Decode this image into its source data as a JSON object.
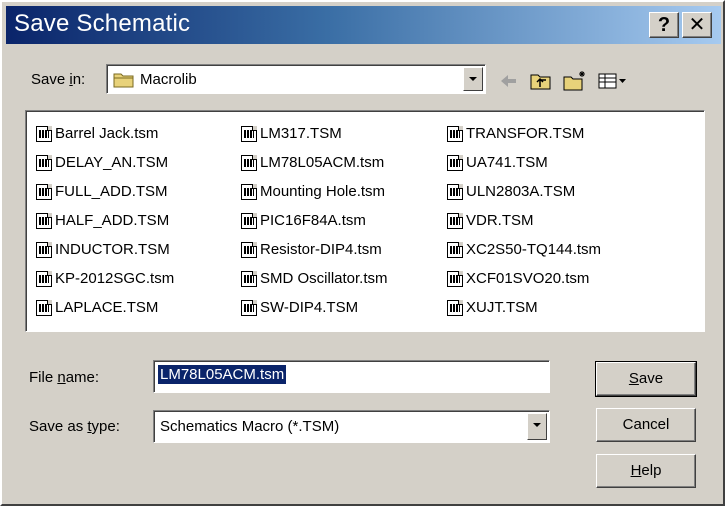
{
  "window": {
    "title": "Save Schematic",
    "help_glyph": "?",
    "close_glyph": "✕"
  },
  "save_in": {
    "label_pre": "Save ",
    "label_u": "i",
    "label_post": "n:",
    "value": "Macrolib",
    "folder_icon": "folder-icon"
  },
  "toolbar": {
    "back_icon": "back-arrow-icon",
    "up_icon": "up-folder-icon",
    "new_folder_icon": "new-folder-icon",
    "view_icon": "view-menu-icon"
  },
  "files": {
    "col1": [
      "Barrel Jack.tsm",
      "DELAY_AN.TSM",
      "FULL_ADD.TSM",
      "HALF_ADD.TSM",
      "INDUCTOR.TSM",
      "KP-2012SGC.tsm",
      "LAPLACE.TSM"
    ],
    "col2": [
      "LM317.TSM",
      "LM78L05ACM.tsm",
      "Mounting Hole.tsm",
      "PIC16F84A.tsm",
      "Resistor-DIP4.tsm",
      "SMD Oscillator.tsm",
      "SW-DIP4.TSM"
    ],
    "col3": [
      "TRANSFOR.TSM",
      "UA741.TSM",
      "ULN2803A.TSM",
      "VDR.TSM",
      "XC2S50-TQ144.tsm",
      "XCF01SVO20.tsm",
      "XUJT.TSM"
    ]
  },
  "file_name": {
    "label_pre": "File ",
    "label_u": "n",
    "label_post": "ame:",
    "value": "LM78L05ACM.tsm"
  },
  "save_type": {
    "label_pre": "Save as ",
    "label_u": "t",
    "label_post": "ype:",
    "value": "Schematics Macro (*.TSM)"
  },
  "buttons": {
    "save_u": "S",
    "save_rest": "ave",
    "cancel": "Cancel",
    "help_u": "H",
    "help_rest": "elp"
  }
}
